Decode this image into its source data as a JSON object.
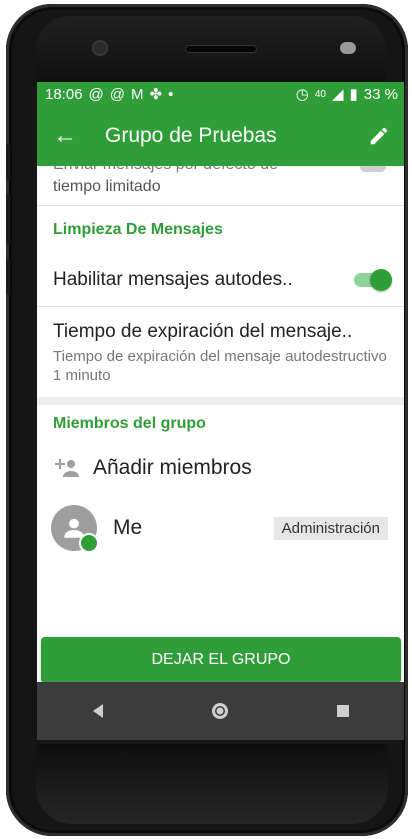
{
  "status_bar": {
    "time": "18:06",
    "notification_icons": [
      "@",
      "@",
      "M",
      "✤",
      "•"
    ],
    "network": "40",
    "battery": "33 %"
  },
  "app_bar": {
    "title": "Grupo de Pruebas",
    "back_icon": "arrow-left-icon",
    "edit_icon": "pencil-icon"
  },
  "settings": {
    "clipped_line1": "Enviar mensajes por defecto de",
    "clipped_line2": "tiempo limitado",
    "section_title": "Limpieza De Mensajes",
    "self_destruct_label": "Habilitar mensajes autodes..",
    "self_destruct_enabled": true,
    "expiry_title": "Tiempo de expiración del mensaje..",
    "expiry_desc": "Tiempo de expiración del mensaje autodestructivo 1 minuto"
  },
  "members": {
    "section_title": "Miembros del grupo",
    "add_label": "Añadir miembros",
    "list": [
      {
        "name": "Me",
        "role": "Administración"
      }
    ]
  },
  "leave_button": "DEJAR EL GRUPO",
  "colors": {
    "primary": "#2f9e38",
    "nav_bar": "#3c3c3c"
  }
}
